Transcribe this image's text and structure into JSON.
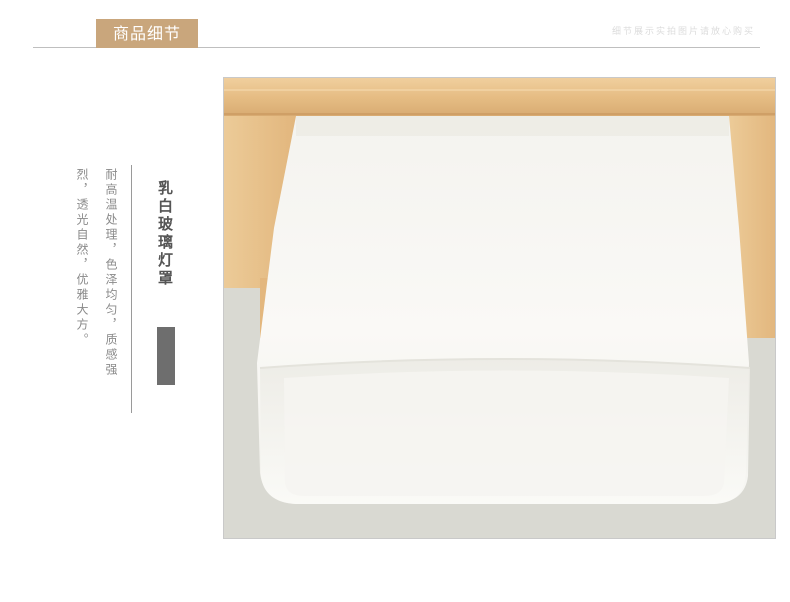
{
  "header": {
    "tag_label": "商品细节",
    "subtitle": "细节展示实拍图片请放心购买"
  },
  "feature": {
    "title": "乳白玻璃灯罩",
    "desc_col1": "耐高温处理，色泽均匀，质感强",
    "desc_col2": "烈，透光自然，优雅大方。"
  },
  "colors": {
    "accent": "#c9a67c",
    "wood": "#e9c48e",
    "glass": "#f7f6f2",
    "background_wall": "#d9d9d2"
  }
}
